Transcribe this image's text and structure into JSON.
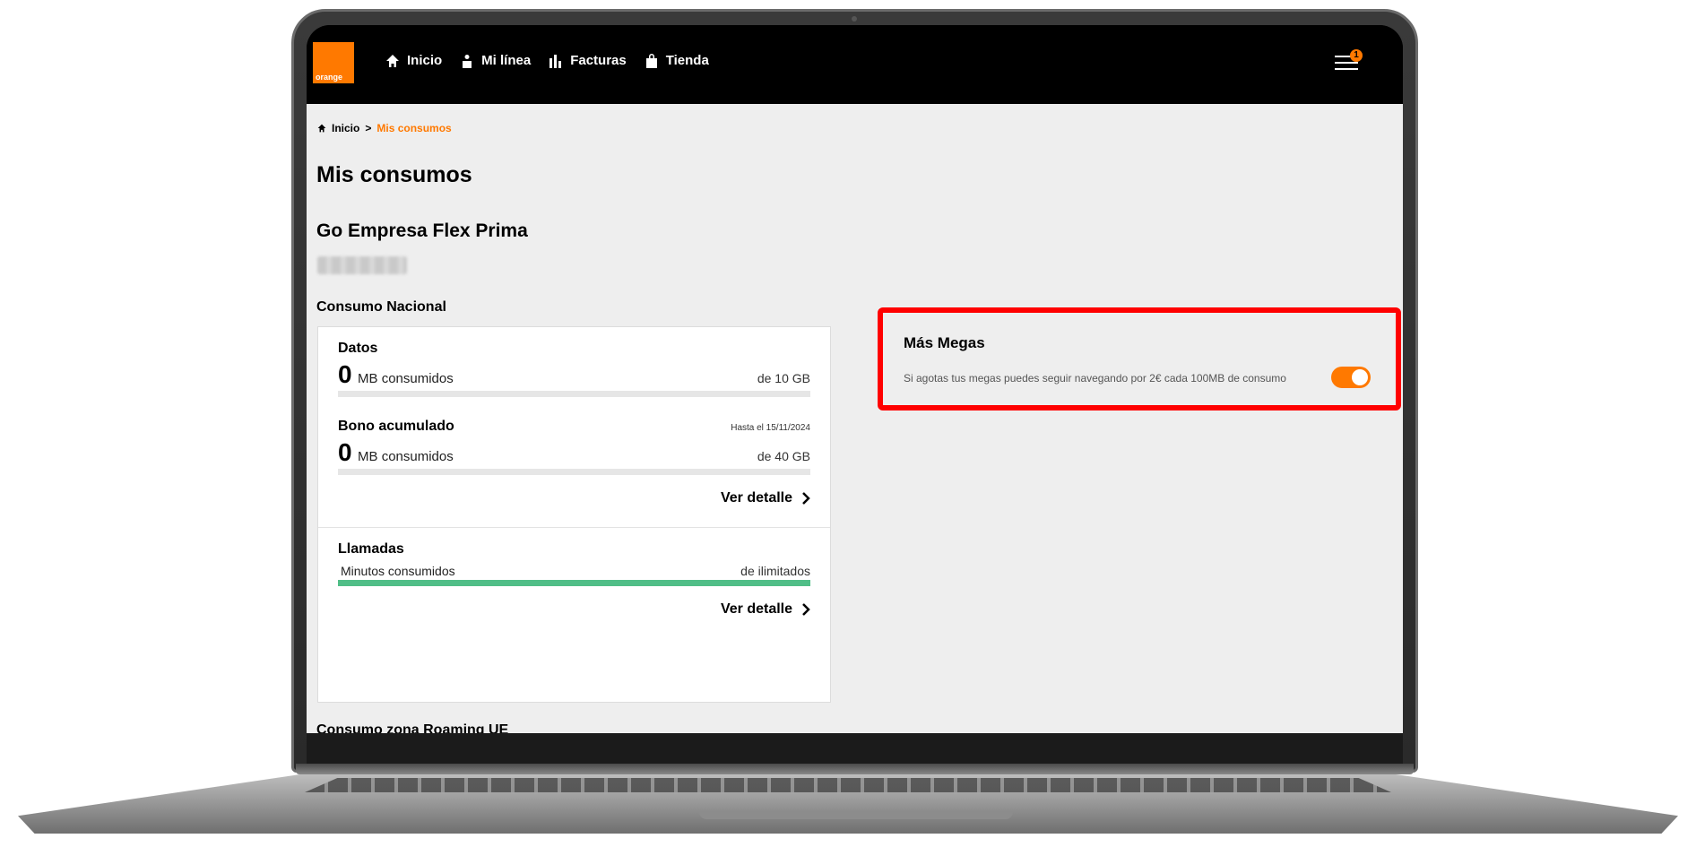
{
  "nav": {
    "logo_text": "orange",
    "items": [
      {
        "label": "Inicio",
        "icon": "home-icon"
      },
      {
        "label": "Mi línea",
        "icon": "person-icon"
      },
      {
        "label": "Facturas",
        "icon": "bar-chart-icon"
      },
      {
        "label": "Tienda",
        "icon": "shopping-bag-icon"
      }
    ],
    "menu_icon": "hamburger-menu-icon",
    "notification_count": "1"
  },
  "breadcrumb": {
    "home": "Inicio",
    "separator": ">",
    "current": "Mis consumos"
  },
  "page": {
    "title": "Mis consumos",
    "plan_name": "Go Empresa Flex Prima",
    "section_title": "Consumo Nacional",
    "next_section_title": "Consumo zona Roaming UE"
  },
  "consumption": {
    "datos": {
      "title": "Datos",
      "value": "0",
      "unit": "MB consumidos",
      "limit": "de 10 GB",
      "progress": 0
    },
    "bono": {
      "title": "Bono acumulado",
      "expiry": "Hasta el 15/11/2024",
      "value": "0",
      "unit": "MB consumidos",
      "limit": "de 40 GB",
      "progress": 0,
      "detail_link": "Ver detalle"
    },
    "llamadas": {
      "title": "Llamadas",
      "label": "Minutos consumidos",
      "limit": "de ilimitados",
      "progress": 1,
      "detail_link": "Ver detalle"
    }
  },
  "mas_megas": {
    "title": "Más Megas",
    "description": "Si agotas tus megas puedes seguir navegando por 2€ cada 100MB de consumo",
    "toggle_on": true
  },
  "colors": {
    "brand_orange": "#ff7900",
    "highlight_red": "#ff0000",
    "progress_green": "#50be87"
  }
}
